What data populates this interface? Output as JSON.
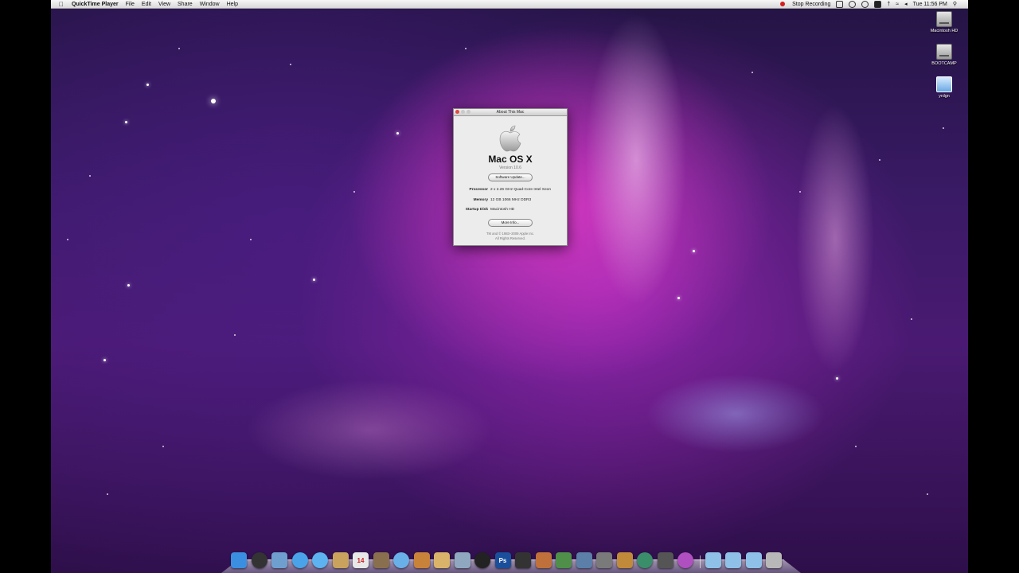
{
  "menubar": {
    "app_name": "QuickTime Player",
    "items": [
      "File",
      "Edit",
      "View",
      "Share",
      "Window",
      "Help"
    ],
    "stop_recording": "Stop Recording",
    "clock": "Tue 11:56 PM"
  },
  "desktop_icons": [
    {
      "label": "Macintosh HD",
      "icon": "hard-drive-icon"
    },
    {
      "label": "BOOTCAMP",
      "icon": "hard-drive-icon"
    },
    {
      "label": "yrdgn",
      "icon": "folder-icon"
    }
  ],
  "about_window": {
    "title": "About This Mac",
    "os_name": "Mac OS X",
    "version": "Version 10.6",
    "software_update_button": "Software Update...",
    "processor_label": "Processor",
    "processor_value": "2 x 2.26 GHz Quad-Core Intel Xeon",
    "memory_label": "Memory",
    "memory_value": "12 GB 1066 MHz DDR3",
    "startup_label": "Startup Disk",
    "startup_value": "Macintosh HD",
    "more_info_button": "More Info...",
    "footer_line1": "TM and © 1983–2009 Apple Inc.",
    "footer_line2": "All Rights Reserved."
  },
  "dock": {
    "apps": [
      {
        "name": "finder-icon",
        "color": "#3b8fe0"
      },
      {
        "name": "dashboard-icon",
        "color": "#333333"
      },
      {
        "name": "preview-icon",
        "color": "#6f9fcf"
      },
      {
        "name": "safari-icon",
        "color": "#4aa3e8"
      },
      {
        "name": "ichat-icon",
        "color": "#5db3f0"
      },
      {
        "name": "address-book-icon",
        "color": "#c9a35d"
      },
      {
        "name": "ical-icon",
        "color": "#e8e8e8",
        "text": "14"
      },
      {
        "name": "preview-photos-icon",
        "color": "#8a6f4f"
      },
      {
        "name": "itunes-icon",
        "color": "#6ab0e8"
      },
      {
        "name": "iphoto-icon",
        "color": "#c9823a"
      },
      {
        "name": "iweb-icon",
        "color": "#d9b36a"
      },
      {
        "name": "imovie-icon",
        "color": "#8fa8c0"
      },
      {
        "name": "dvd-player-icon",
        "color": "#222222"
      },
      {
        "name": "photoshop-icon",
        "color": "#1a4f9c",
        "text": "Ps"
      },
      {
        "name": "final-cut-icon",
        "color": "#333333"
      },
      {
        "name": "keynote-icon",
        "color": "#c0703a"
      },
      {
        "name": "numbers-icon",
        "color": "#4f8f4a"
      },
      {
        "name": "xcode-icon",
        "color": "#5b7fa8"
      },
      {
        "name": "system-preferences-icon",
        "color": "#7a7a7a"
      },
      {
        "name": "garageband-icon",
        "color": "#c08a3a"
      },
      {
        "name": "time-machine-icon",
        "color": "#3a8f6a"
      },
      {
        "name": "activity-monitor-icon",
        "color": "#555555"
      },
      {
        "name": "front-row-icon",
        "color": "#b050c0"
      }
    ],
    "stacks": [
      {
        "name": "applications-folder-icon",
        "color": "#8fc0e8"
      },
      {
        "name": "documents-folder-icon",
        "color": "#8fc0e8"
      },
      {
        "name": "downloads-folder-icon",
        "color": "#8fc0e8"
      },
      {
        "name": "trash-icon",
        "color": "#b8b8b8"
      }
    ]
  }
}
